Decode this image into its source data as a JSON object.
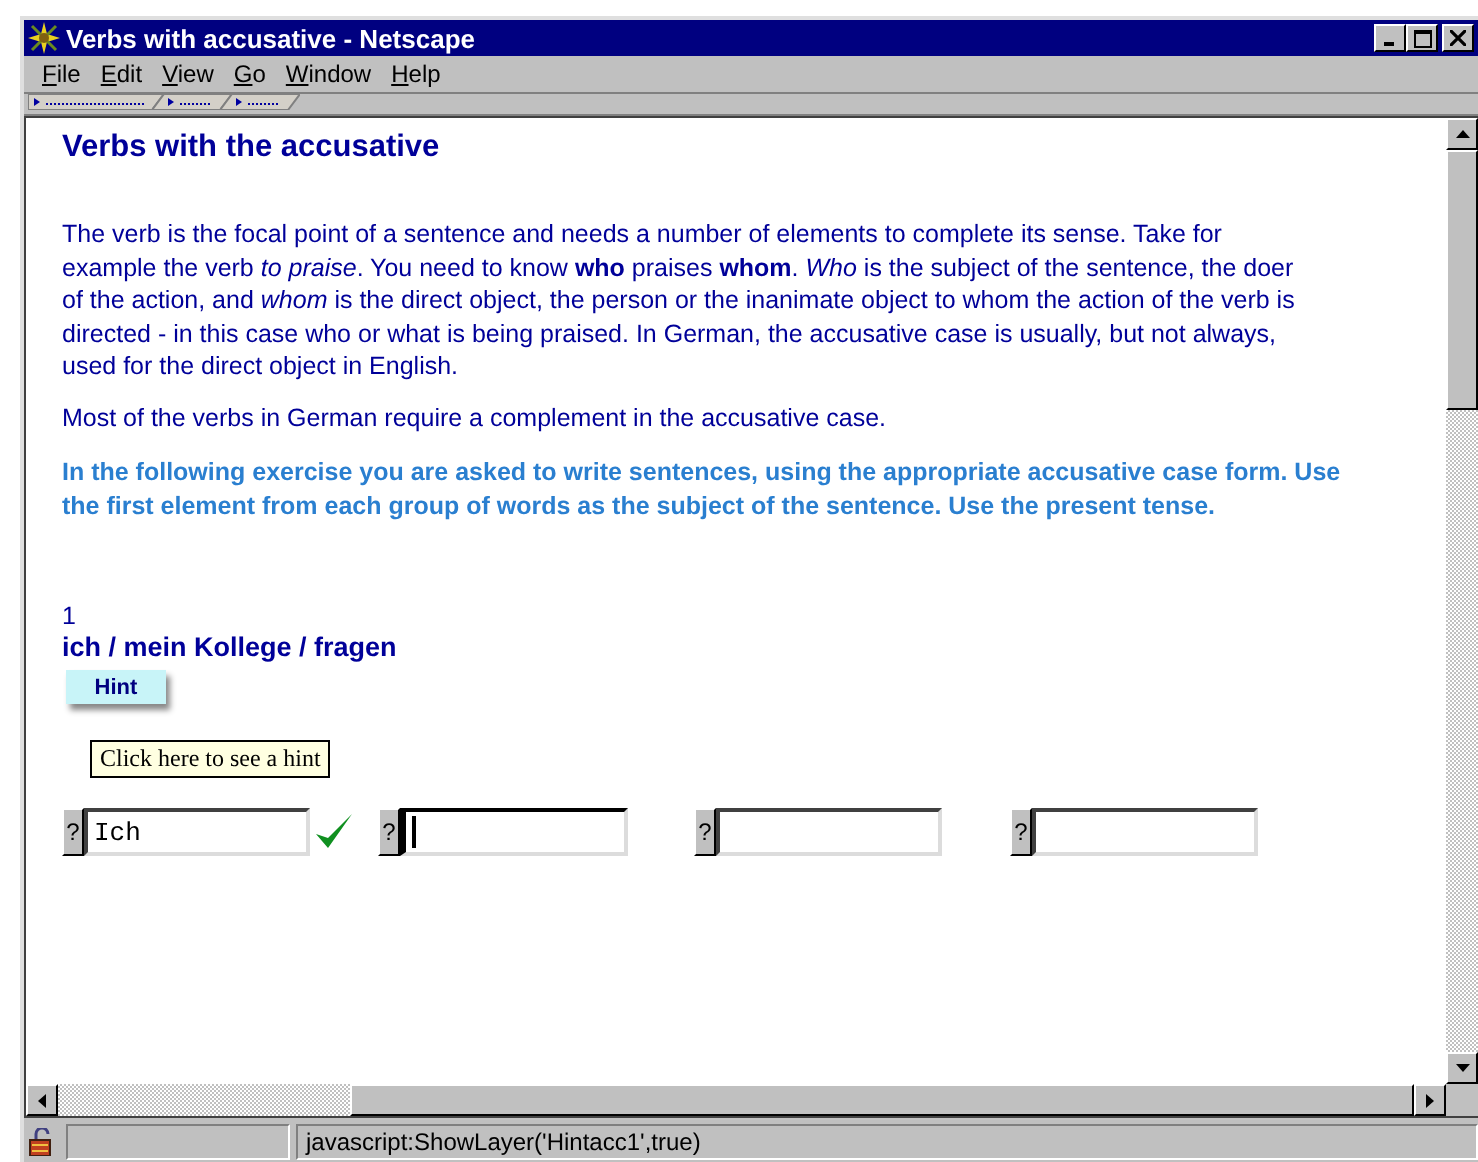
{
  "window": {
    "title": "Verbs with accusative - Netscape"
  },
  "menu": [
    {
      "label": "File"
    },
    {
      "label": "Edit"
    },
    {
      "label": "View"
    },
    {
      "label": "Go"
    },
    {
      "label": "Window"
    },
    {
      "label": "Help"
    }
  ],
  "page": {
    "heading": "Verbs with the accusative",
    "paragraphs": [
      {
        "kind": "plain",
        "text": "The verb is the focal point of a sentence and needs a number of elements to complete its sense. Take for example the verb *to praise*. You need to know **who** praises **whom**. *Who* is the subject of the sentence, the doer of the action, and *whom* is the direct object, the person or the inanimate object to whom the action of the verb is directed - in this case who or what is being praised. In German, the accusative case is usually, but not always, used for the direct object in English."
      },
      {
        "kind": "plain",
        "text": "Most of the verbs in German require a complement in the accusative case."
      },
      {
        "kind": "instruction",
        "text": "In the following exercise you are asked to write sentences, using the appropriate accusative case form. Use the first element from each group of words as the subject of the sentence. Use the present tense."
      }
    ],
    "exercise": {
      "number": "1",
      "prompt": "ich / mein Kollege / fragen",
      "hint_button": "Hint",
      "tooltip": "Click here to see a hint",
      "fields": [
        {
          "help": "?",
          "value": "Ich",
          "correct": true,
          "focused": false
        },
        {
          "help": "?",
          "correct": false,
          "focused": true
        },
        {
          "help": "?",
          "correct": false,
          "focused": false
        },
        {
          "help": "?",
          "correct": false,
          "focused": false
        }
      ]
    }
  },
  "status_bar": {
    "text": "javascript:ShowLayer('Hintacc1',true)"
  }
}
